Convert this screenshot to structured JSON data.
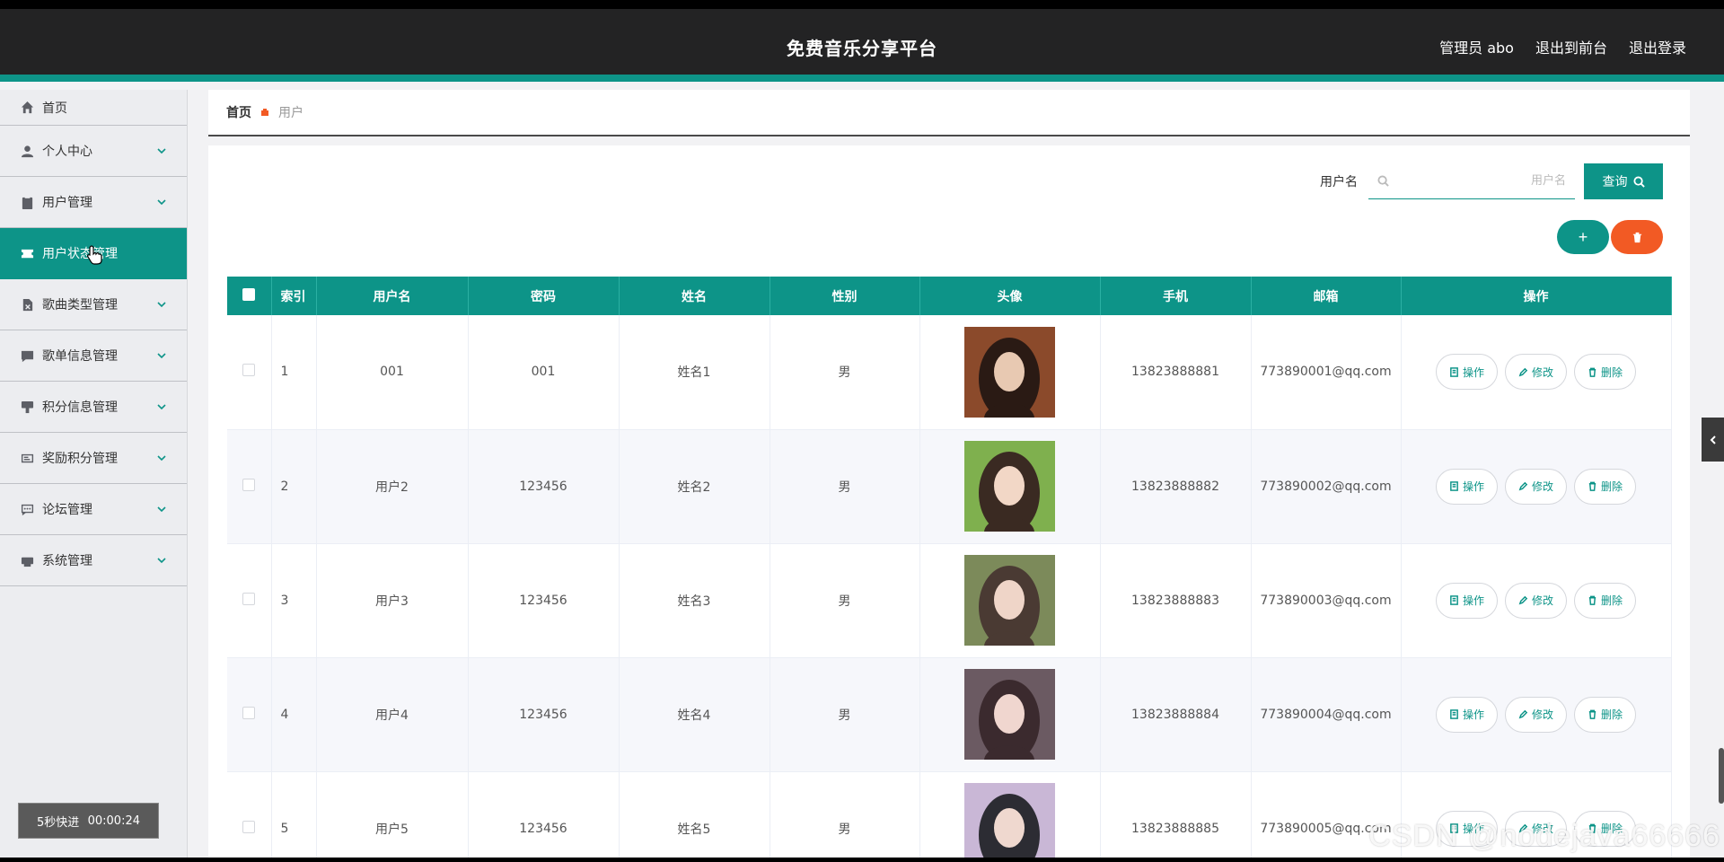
{
  "header": {
    "title": "免费音乐分享平台",
    "links": [
      "管理员 abo",
      "退出到前台",
      "退出登录"
    ]
  },
  "sidebar": {
    "items": [
      {
        "label": "首页",
        "icon": "home-icon",
        "expandable": false
      },
      {
        "label": "个人中心",
        "icon": "user-icon",
        "expandable": true
      },
      {
        "label": "用户管理",
        "icon": "clipboard-icon",
        "expandable": true
      },
      {
        "label": "用户状态管理",
        "icon": "ticket-icon",
        "expandable": false,
        "active": true
      },
      {
        "label": "歌曲类型管理",
        "icon": "doc-x-icon",
        "expandable": true
      },
      {
        "label": "歌单信息管理",
        "icon": "chat-icon",
        "expandable": true
      },
      {
        "label": "积分信息管理",
        "icon": "stamp-icon",
        "expandable": true
      },
      {
        "label": "奖励积分管理",
        "icon": "card-icon",
        "expandable": true
      },
      {
        "label": "论坛管理",
        "icon": "comment-icon",
        "expandable": true
      },
      {
        "label": "系统管理",
        "icon": "printer-icon",
        "expandable": true
      }
    ]
  },
  "breadcrumb": {
    "home": "首页",
    "current": "用户"
  },
  "search": {
    "label": "用户名",
    "placeholder": "用户名",
    "value": "",
    "button": "查询"
  },
  "table": {
    "columns": [
      "索引",
      "用户名",
      "密码",
      "姓名",
      "性别",
      "头像",
      "手机",
      "邮箱",
      "操作"
    ],
    "actions": [
      "操作",
      "修改",
      "删除"
    ],
    "rows": [
      {
        "index": "1",
        "username": "001",
        "password": "001",
        "name": "姓名1",
        "gender": "男",
        "phone": "13823888881",
        "email": "773890001@qq.com"
      },
      {
        "index": "2",
        "username": "用户2",
        "password": "123456",
        "name": "姓名2",
        "gender": "男",
        "phone": "13823888882",
        "email": "773890002@qq.com"
      },
      {
        "index": "3",
        "username": "用户3",
        "password": "123456",
        "name": "姓名3",
        "gender": "男",
        "phone": "13823888883",
        "email": "773890003@qq.com"
      },
      {
        "index": "4",
        "username": "用户4",
        "password": "123456",
        "name": "姓名4",
        "gender": "男",
        "phone": "13823888884",
        "email": "773890004@qq.com"
      },
      {
        "index": "5",
        "username": "用户5",
        "password": "123456",
        "name": "姓名5",
        "gender": "男",
        "phone": "13823888885",
        "email": "773890005@qq.com"
      }
    ]
  },
  "overlay": {
    "speed_label": "5秒快进",
    "time": "00:00:24"
  },
  "watermark": "CSDN @nodejava66666",
  "colors": {
    "accent": "#0d9488",
    "danger": "#f25a24",
    "header_bg": "#232324"
  }
}
